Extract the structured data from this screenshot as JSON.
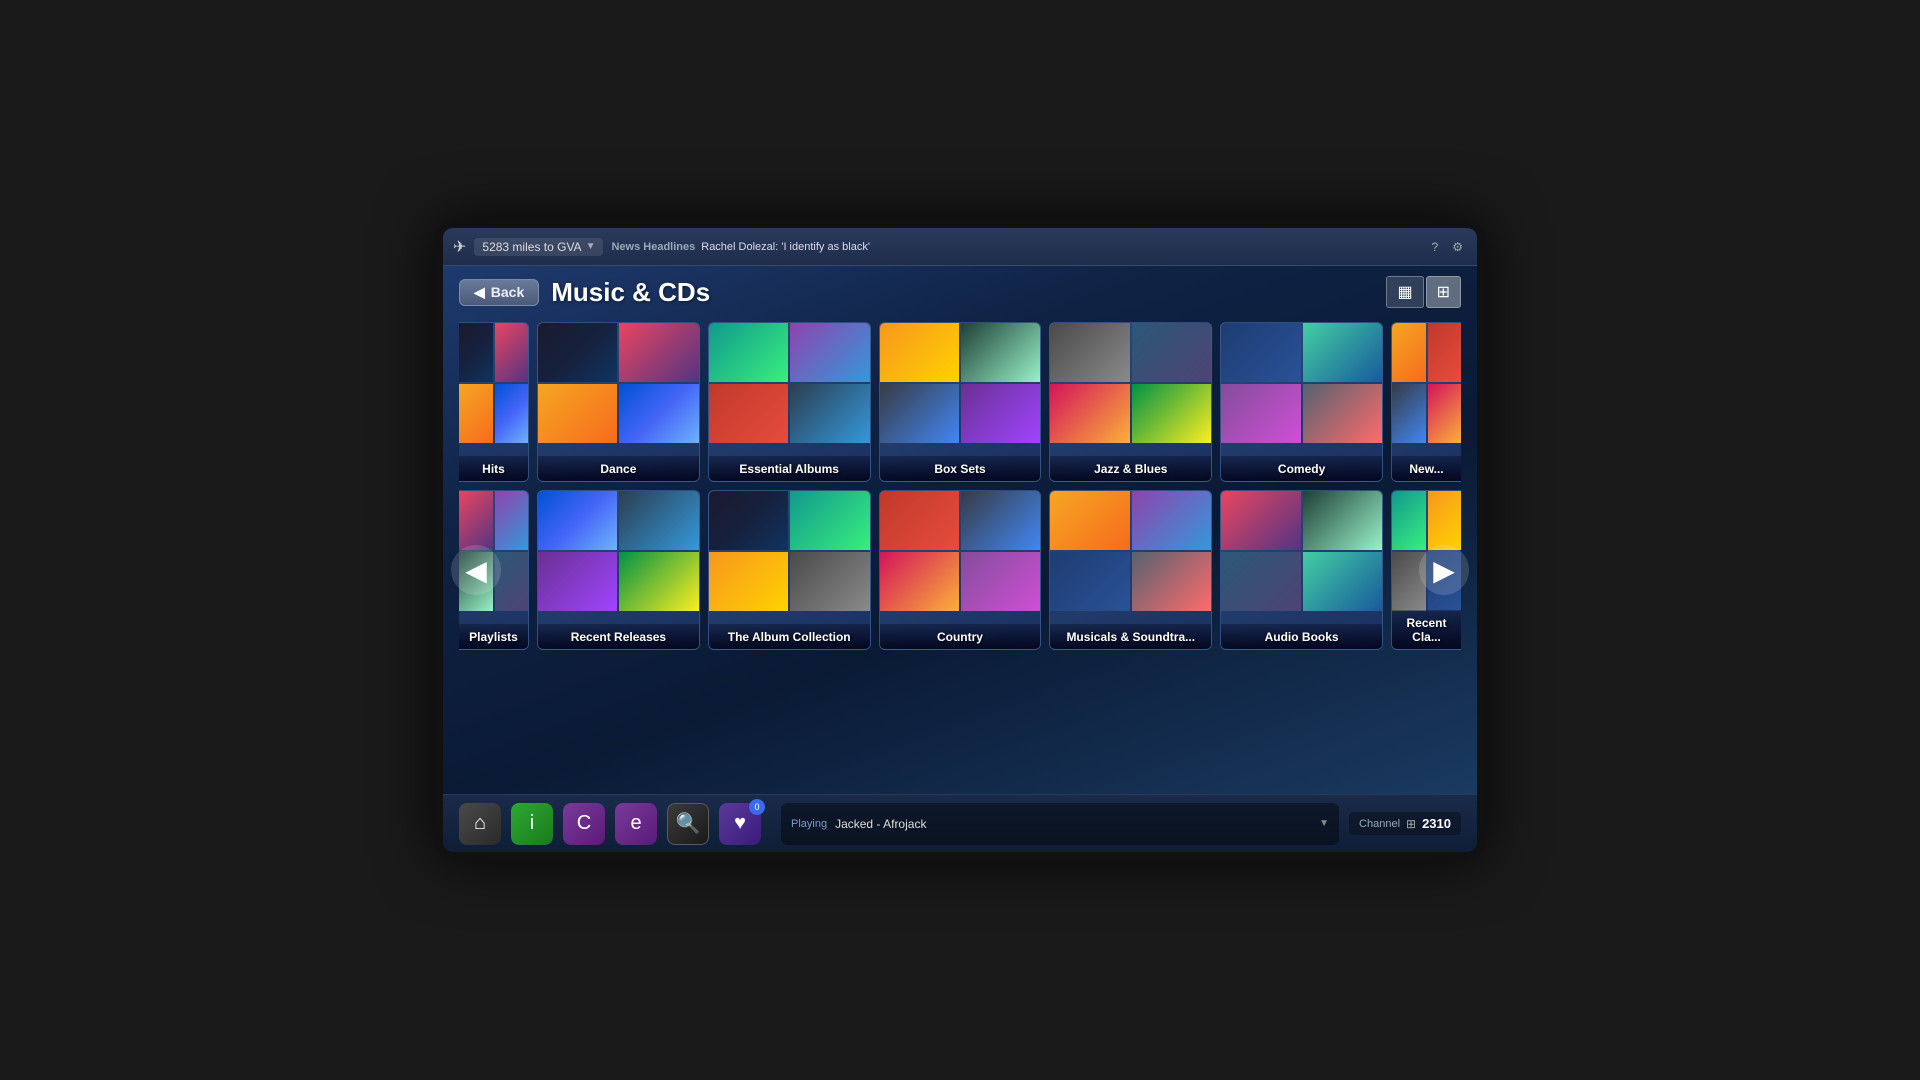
{
  "topbar": {
    "flight_miles": "5283 miles to GVA",
    "news_label": "News Headlines",
    "news_text": "Rachel Dolezal: 'I identify as black'",
    "help_icon": "?",
    "settings_icon": "⚙"
  },
  "header": {
    "back_label": "Back",
    "title": "Music & CDs"
  },
  "view_toggles": {
    "list_icon": "▦",
    "grid_icon": "⊞"
  },
  "categories_row1": [
    {
      "id": "hits",
      "label": "Hits",
      "partial": "left",
      "arts": [
        "art-1",
        "art-2",
        "art-3",
        "art-4"
      ]
    },
    {
      "id": "dance",
      "label": "Dance",
      "arts": [
        "art-1",
        "art-2",
        "art-3",
        "art-4"
      ]
    },
    {
      "id": "essential-albums",
      "label": "Essential Albums",
      "arts": [
        "art-5",
        "art-6",
        "art-7",
        "art-8"
      ]
    },
    {
      "id": "box-sets",
      "label": "Box Sets",
      "arts": [
        "art-9",
        "art-10",
        "art-11",
        "art-12"
      ]
    },
    {
      "id": "jazz-blues",
      "label": "Jazz & Blues",
      "arts": [
        "art-13",
        "art-14",
        "art-15",
        "art-16"
      ]
    },
    {
      "id": "comedy",
      "label": "Comedy",
      "arts": [
        "art-17",
        "art-18",
        "art-19",
        "art-20"
      ]
    },
    {
      "id": "new-partial-r1",
      "label": "New...",
      "partial": "right",
      "arts": [
        "art-3",
        "art-7",
        "art-11",
        "art-15"
      ]
    }
  ],
  "categories_row2": [
    {
      "id": "playlists",
      "label": "Playlists",
      "partial": "left",
      "arts": [
        "art-2",
        "art-6",
        "art-10",
        "art-14"
      ]
    },
    {
      "id": "recent-releases",
      "label": "Recent Releases",
      "arts": [
        "art-4",
        "art-8",
        "art-12",
        "art-16"
      ]
    },
    {
      "id": "album-collection",
      "label": "The Album Collection",
      "arts": [
        "art-1",
        "art-5",
        "art-9",
        "art-13"
      ]
    },
    {
      "id": "country",
      "label": "Country",
      "arts": [
        "art-7",
        "art-11",
        "art-15",
        "art-19"
      ]
    },
    {
      "id": "musicals-soundtracks",
      "label": "Musicals & Soundtra...",
      "arts": [
        "art-3",
        "art-6",
        "art-17",
        "art-20"
      ]
    },
    {
      "id": "audio-books",
      "label": "Audio Books",
      "arts": [
        "art-2",
        "art-10",
        "art-14",
        "art-18"
      ]
    },
    {
      "id": "recent-classics",
      "label": "Recent Cla...",
      "partial": "right",
      "arts": [
        "art-5",
        "art-9",
        "art-13",
        "art-17"
      ]
    }
  ],
  "nav": {
    "prev_arrow": "◀",
    "next_arrow": "▶"
  },
  "bottom_nav": {
    "home_icon": "⌂",
    "info_icon": "i",
    "chat_icon": "C",
    "e_icon": "e",
    "search_icon": "🔍",
    "heart_icon": "♥",
    "heart_badge": "0"
  },
  "player": {
    "playing_label": "Playing",
    "track_name": "Jacked - Afrojack",
    "channel_label": "Channel",
    "channel_number": "2310"
  }
}
